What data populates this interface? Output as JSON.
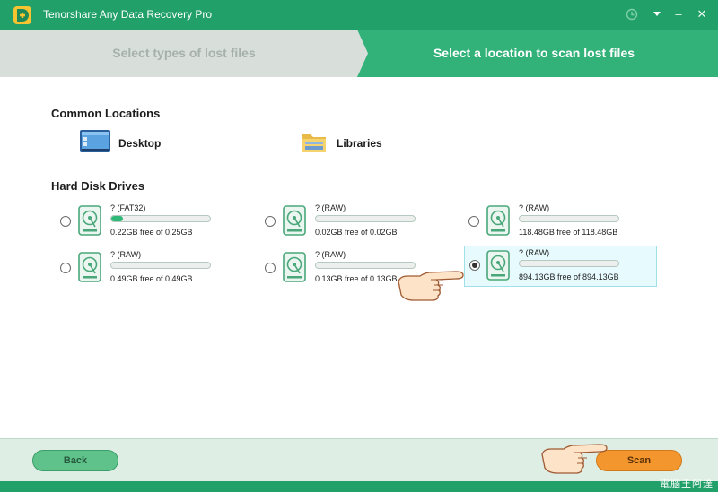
{
  "window": {
    "title": "Tenorshare Any Data Recovery Pro",
    "controls": {
      "history_icon": "history-icon",
      "menu_icon": "chevron-down-icon",
      "minimize": "–",
      "close": "✕"
    }
  },
  "steps": {
    "step1": "Select types of lost files",
    "step2": "Select a location to scan lost files"
  },
  "common_locations": {
    "title": "Common Locations",
    "items": [
      {
        "label": "Desktop",
        "icon": "desktop-icon"
      },
      {
        "label": "Libraries",
        "icon": "folder-icon"
      }
    ]
  },
  "hard_disk_drives": {
    "title": "Hard Disk Drives",
    "drives": [
      {
        "name": "? (FAT32)",
        "free_text": "0.22GB free of 0.25GB",
        "used_fraction": 0.12,
        "selected": false
      },
      {
        "name": "? (RAW)",
        "free_text": "0.02GB free of 0.02GB",
        "used_fraction": 0,
        "selected": false
      },
      {
        "name": "? (RAW)",
        "free_text": "118.48GB free of 118.48GB",
        "used_fraction": 0,
        "selected": false
      },
      {
        "name": "? (RAW)",
        "free_text": "0.49GB free of 0.49GB",
        "used_fraction": 0,
        "selected": false
      },
      {
        "name": "? (RAW)",
        "free_text": "0.13GB free of 0.13GB",
        "used_fraction": 0,
        "selected": false
      },
      {
        "name": "? (RAW)",
        "free_text": "894.13GB free of 894.13GB",
        "used_fraction": 0,
        "selected": true
      }
    ]
  },
  "footer": {
    "back_label": "Back",
    "scan_label": "Scan"
  },
  "watermark": "電腦王阿達",
  "colors": {
    "brand_green": "#22a06a",
    "scan_orange": "#f3962e",
    "selected_bg": "#e7fbff"
  }
}
